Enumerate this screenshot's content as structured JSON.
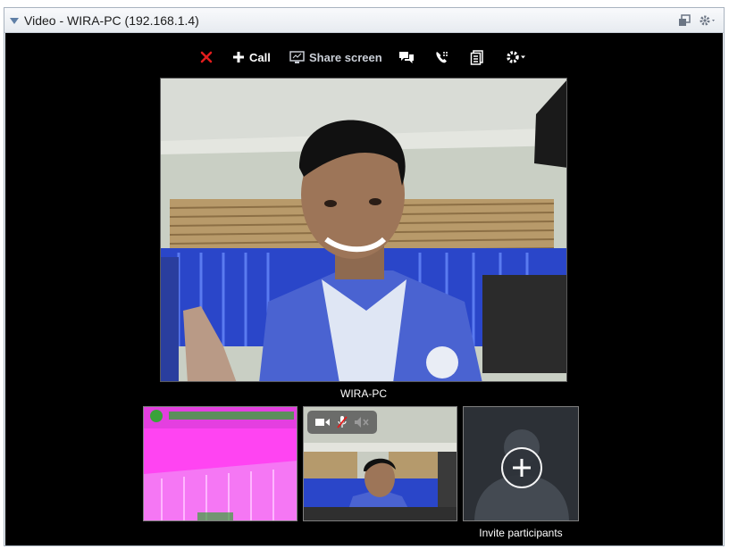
{
  "window": {
    "title": "Video - WIRA-PC (192.168.1.4)"
  },
  "toolbar": {
    "hangup_icon": "close-icon",
    "call_label": "Call",
    "share_label": "Share screen",
    "chat_icon": "chat-bubbles-icon",
    "dialpad_icon": "phone-dialpad-icon",
    "details_icon": "document-icon",
    "settings_icon": "gear-icon"
  },
  "main_video": {
    "participant_name": "WIRA-PC"
  },
  "thumbnails": {
    "invite_label": "Invite participants",
    "media_controls": [
      "camera-icon",
      "microphone-muted-icon",
      "speaker-muted-icon"
    ]
  },
  "colors": {
    "hangup": "#e21d1d",
    "video_background": "#000000",
    "thumbnail_tint": "#ff40ff"
  }
}
